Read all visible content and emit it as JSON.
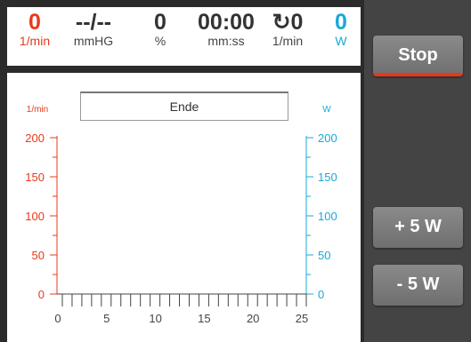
{
  "stats": [
    {
      "value": "0",
      "unit": "1/min",
      "color": "red"
    },
    {
      "value": "--/--",
      "unit": "mmHG"
    },
    {
      "value": "0",
      "unit": "%"
    },
    {
      "value": "00:00",
      "unit": "mm:ss"
    },
    {
      "value": "↻0",
      "unit": "1/min"
    },
    {
      "value": "0",
      "unit": "W",
      "color": "blue"
    }
  ],
  "status_text": "Ende",
  "buttons": {
    "stop": "Stop",
    "plus": "+ 5 W",
    "minus": "- 5 W"
  },
  "colors": {
    "red": "#e8391c",
    "blue": "#1aa8d8",
    "panel": "#444444"
  },
  "chart_data": {
    "type": "line",
    "left_axis": {
      "label": "1/min",
      "ticks": [
        "0",
        "50",
        "100",
        "150",
        "200"
      ],
      "range": [
        0,
        200
      ],
      "color": "#e8391c"
    },
    "right_axis": {
      "label": "W",
      "ticks": [
        "0",
        "50",
        "100",
        "150",
        "200"
      ],
      "range": [
        0,
        200
      ],
      "color": "#1aa8d8"
    },
    "x_axis": {
      "ticks": [
        "0",
        "5",
        "10",
        "15",
        "20",
        "25"
      ],
      "range": [
        0,
        25
      ]
    },
    "series": []
  }
}
